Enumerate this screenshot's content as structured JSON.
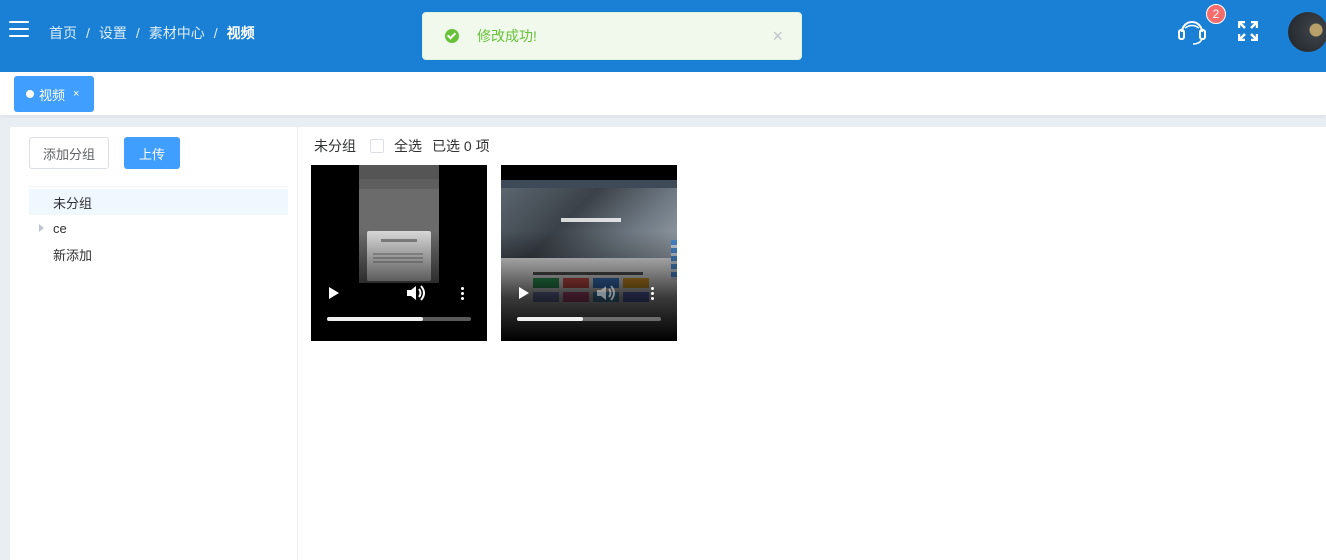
{
  "header": {
    "breadcrumb": [
      "首页",
      "设置",
      "素材中心",
      "视频"
    ],
    "badge_count": "2",
    "accent_color": "#1a80d6"
  },
  "toast": {
    "message": "修改成功!",
    "close_label": "×",
    "color": "#67c23a"
  },
  "tags": [
    {
      "label": "视频",
      "close": "×"
    }
  ],
  "sidebar": {
    "add_group_label": "添加分组",
    "upload_label": "上传",
    "tree": [
      {
        "label": "未分组",
        "active": true,
        "expandable": false
      },
      {
        "label": "ce",
        "active": false,
        "expandable": true
      },
      {
        "label": "新添加",
        "active": false,
        "expandable": false
      }
    ]
  },
  "content": {
    "group_title": "未分组",
    "select_all_label": "全选",
    "selected_text": "已选 0 项",
    "videos": [
      {
        "progress": 0.67
      },
      {
        "progress": 0.46
      }
    ]
  }
}
